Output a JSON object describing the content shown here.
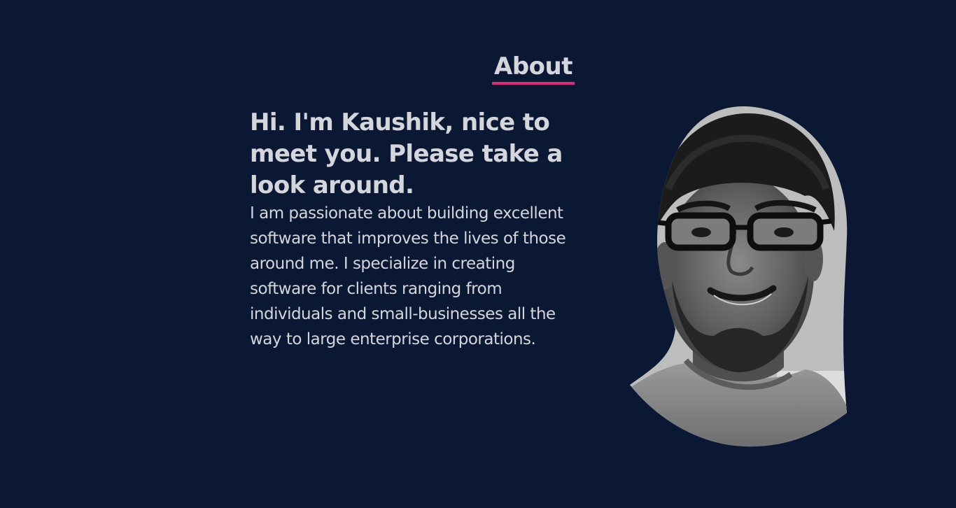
{
  "about": {
    "title": "About",
    "heading": "Hi. I'm Kaushik, nice to meet you. Please take a look around.",
    "body": "I am passionate about building excellent software that improves the lives of those around me. I specialize in creating software for clients ranging from individuals and small-businesses all the way to large enterprise corporations."
  },
  "colors": {
    "background": "#0b1833",
    "text": "#d4d6dc",
    "accent": "#e0297a"
  },
  "portrait": {
    "icon": "profile-photo"
  }
}
